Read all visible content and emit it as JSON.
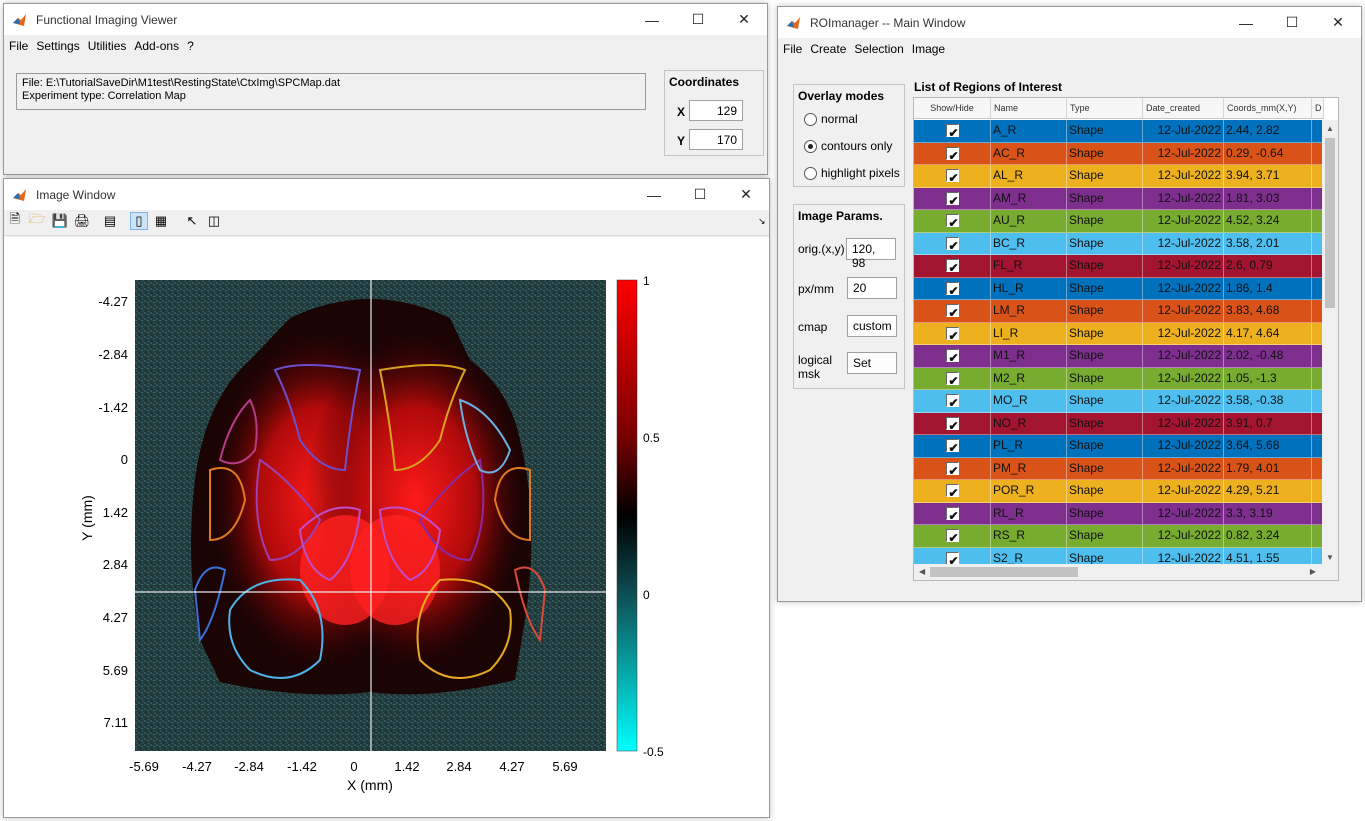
{
  "fiv": {
    "title": "Functional Imaging Viewer",
    "menu": [
      "File",
      "Settings",
      "Utilities",
      "Add-ons",
      "?"
    ],
    "file_line": "File: E:\\TutorialSaveDir\\M1test\\RestingState\\CtxImg\\SPCMap.dat",
    "exp_line": "Experiment type: Correlation Map",
    "coords_title": "Coordinates",
    "x_label": "X",
    "x_value": "129",
    "y_label": "Y",
    "y_value": "170"
  },
  "imgwin": {
    "title": "Image Window",
    "tools": [
      "new-file-icon",
      "open-folder-icon",
      "save-icon",
      "print-icon",
      "link-plot-icon",
      "colorbar-icon",
      "legend-icon",
      "pointer-icon",
      "property-inspector-icon"
    ],
    "xlabel": "X (mm)",
    "ylabel": "Y (mm)",
    "xticks": [
      "-5.69",
      "-4.27",
      "-2.84",
      "-1.42",
      "0",
      "1.42",
      "2.84",
      "4.27",
      "5.69"
    ],
    "yticks": [
      "-4.27",
      "-2.84",
      "-1.42",
      "0",
      "1.42",
      "2.84",
      "4.27",
      "5.69",
      "7.11"
    ],
    "cticks": [
      "1",
      "0.5",
      "0",
      "-0.5"
    ]
  },
  "roi": {
    "title": "ROImanager -- Main Window",
    "menu": [
      "File",
      "Create",
      "Selection",
      "Image"
    ],
    "overlay_title": "Overlay modes",
    "overlay_options": [
      "normal",
      "contours only",
      "highlight pixels"
    ],
    "overlay_selected": "contours only",
    "params_title": "Image Params.",
    "orig_label": "orig.(x,y)",
    "orig_value": "120, 98",
    "pxmm_label": "px/mm",
    "pxmm_value": "20",
    "cmap_label": "cmap",
    "cmap_value": "custom",
    "mask_label": "logical msk",
    "mask_button": "Set",
    "list_title": "List of Regions of Interest",
    "columns": [
      "Show/Hide",
      "Name",
      "Type",
      "Date_created",
      "Coords_mm(X,Y)",
      "D"
    ],
    "rows": [
      {
        "name": "A_R",
        "type": "Shape",
        "date": "12-Jul-2022",
        "coords": "2.44, 2.82",
        "color": "#0072BD"
      },
      {
        "name": "AC_R",
        "type": "Shape",
        "date": "12-Jul-2022",
        "coords": "0.29, -0.64",
        "color": "#D95319"
      },
      {
        "name": "AL_R",
        "type": "Shape",
        "date": "12-Jul-2022",
        "coords": "3.94, 3.71",
        "color": "#EDB120"
      },
      {
        "name": "AM_R",
        "type": "Shape",
        "date": "12-Jul-2022",
        "coords": "1.81, 3.03",
        "color": "#7E2F8E"
      },
      {
        "name": "AU_R",
        "type": "Shape",
        "date": "12-Jul-2022",
        "coords": "4.52, 3.24",
        "color": "#77AC30"
      },
      {
        "name": "BC_R",
        "type": "Shape",
        "date": "12-Jul-2022",
        "coords": "3.58, 2.01",
        "color": "#4DBEEE"
      },
      {
        "name": "FL_R",
        "type": "Shape",
        "date": "12-Jul-2022",
        "coords": "2.6, 0.79",
        "color": "#A2142F"
      },
      {
        "name": "HL_R",
        "type": "Shape",
        "date": "12-Jul-2022",
        "coords": "1.86, 1.4",
        "color": "#0072BD"
      },
      {
        "name": "LM_R",
        "type": "Shape",
        "date": "12-Jul-2022",
        "coords": "3.83, 4.68",
        "color": "#D95319"
      },
      {
        "name": "LI_R",
        "type": "Shape",
        "date": "12-Jul-2022",
        "coords": "4.17, 4.64",
        "color": "#EDB120"
      },
      {
        "name": "M1_R",
        "type": "Shape",
        "date": "12-Jul-2022",
        "coords": "2.02, -0.48",
        "color": "#7E2F8E"
      },
      {
        "name": "M2_R",
        "type": "Shape",
        "date": "12-Jul-2022",
        "coords": "1.05, -1.3",
        "color": "#77AC30"
      },
      {
        "name": "MO_R",
        "type": "Shape",
        "date": "12-Jul-2022",
        "coords": "3.58, -0.38",
        "color": "#4DBEEE"
      },
      {
        "name": "NO_R",
        "type": "Shape",
        "date": "12-Jul-2022",
        "coords": "3.91, 0.7",
        "color": "#A2142F"
      },
      {
        "name": "PL_R",
        "type": "Shape",
        "date": "12-Jul-2022",
        "coords": "3.64, 5.68",
        "color": "#0072BD"
      },
      {
        "name": "PM_R",
        "type": "Shape",
        "date": "12-Jul-2022",
        "coords": "1.79, 4.01",
        "color": "#D95319"
      },
      {
        "name": "POR_R",
        "type": "Shape",
        "date": "12-Jul-2022",
        "coords": "4.29, 5.21",
        "color": "#EDB120"
      },
      {
        "name": "RL_R",
        "type": "Shape",
        "date": "12-Jul-2022",
        "coords": "3.3, 3.19",
        "color": "#7E2F8E"
      },
      {
        "name": "RS_R",
        "type": "Shape",
        "date": "12-Jul-2022",
        "coords": "0.82, 3.24",
        "color": "#77AC30"
      },
      {
        "name": "S2_R",
        "type": "Shape",
        "date": "12-Jul-2022",
        "coords": "4.51, 1.55",
        "color": "#4DBEEE"
      }
    ]
  }
}
